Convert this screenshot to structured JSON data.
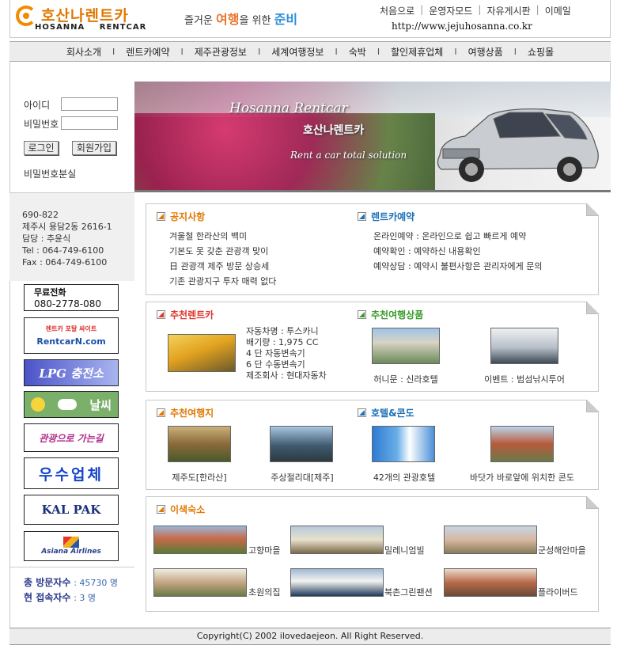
{
  "header": {
    "logo_ko": "호산나렌트카",
    "logo_en": "HOSANNA RENTCAR",
    "slogan_pre": "즐거운 ",
    "slogan_a": "여행",
    "slogan_mid": "을 위한 ",
    "slogan_b": "준비",
    "links": [
      "처음으로",
      "운영자모드",
      "자유게시판",
      "이메일"
    ],
    "url": "http://www.jejuhosanna.co.kr"
  },
  "nav": [
    "회사소개",
    "렌트카예약",
    "제주관광정보",
    "세계여행정보",
    "숙박",
    "할인제휴업체",
    "여행상품",
    "쇼핑몰"
  ],
  "login": {
    "id_label": "아이디",
    "pw_label": "비밀번호",
    "login_button": "로그인",
    "join_button": "회원가입",
    "lost_pw": "비밀번호분실"
  },
  "address": [
    "690-822",
    "제주시 용담2동 2616-1",
    "담당 : 추윤식",
    "Tel : 064-749-6100",
    "Fax : 064-749-6100"
  ],
  "banners": {
    "toll_title": "무료전화",
    "toll_number": "080-2778-080",
    "rentcarn_top": "렌트카 포탈 싸이트",
    "rentcarn": "RentcarN.com",
    "lpg": "LPG 충전소",
    "weather": "날씨",
    "road": "관광으로 가는길",
    "best": "우수업체",
    "kalpak": "KAL PAK",
    "asiana": "Asiana Airlines"
  },
  "stats": {
    "total_label": "총 방문자수",
    "total_value": ": 45730 명",
    "now_label": "현 접속자수",
    "now_value": ": 3 명"
  },
  "hero": {
    "title_en": "Hosanna Rentcar",
    "title_ko": "호산나렌트카",
    "tagline": "Rent a car total solution"
  },
  "notice": {
    "title": "공지사항",
    "items": [
      "겨울철 한라산의 백미",
      "기본도 못 갖춘 관광객 맞이",
      "日 관광객 제주 방문 상승세",
      "기존 관광지구 투자 매력 없다"
    ]
  },
  "reservation": {
    "title": "렌트카예약",
    "items": [
      "온라인예약 : 온라인으로 쉽고 빠르게 예약",
      "예약확인 : 예약하신 내용확인",
      "예약상담 : 예약시 불편사항은 관리자에게 문의"
    ]
  },
  "recommend_car": {
    "title": "추천렌트카",
    "specs": [
      "자동차명 : 투스카니",
      "배기량 : 1,975 CC",
      "4 단 자동변속기",
      "6 단 수동변속기",
      "제조회사 : 현대자동차"
    ]
  },
  "recommend_tour": {
    "title": "추천여행상품",
    "items": [
      "허니문 : 신라호텔",
      "이벤트 : 범섬낚시투어"
    ]
  },
  "recommend_place": {
    "title": "추천여행지",
    "items": [
      "제주도[한라산]",
      "주상절리대[제주]"
    ]
  },
  "hotel": {
    "title": "호텔&콘도",
    "items": [
      "42개의 관광호텔",
      "바닷가 바로앞에 위치한 콘도"
    ]
  },
  "lodging": {
    "title": "이색숙소",
    "items": [
      "고향마을",
      "밀레니엄빌",
      "군성해안마을",
      "초원의집",
      "북촌그린팬션",
      "플라이버드"
    ]
  },
  "footer": "Copyright(C) 2002 ilovedaejeon. All Right Reserved.",
  "colors": {
    "orange": "#e07800",
    "green": "#3a9a2a",
    "red": "#e0342b",
    "blue": "#1a6fb7",
    "nav_bg": "#ececec"
  }
}
